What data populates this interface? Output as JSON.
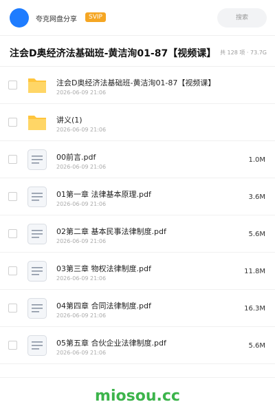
{
  "header": {
    "share_name": "夸克网盘分享",
    "badge": "SVIP",
    "search_label": "搜索"
  },
  "titlebar": {
    "title": "注会D奥经济法基础班-黄洁洵01-87【视频课】",
    "meta": "共 128 项 · 73.7G"
  },
  "files": [
    {
      "type": "folder",
      "name": "注会D奥经济法基础班-黄洁洵01-87【视频课】",
      "date": "2026-06-09 21:06",
      "size": ""
    },
    {
      "type": "folder",
      "name": "讲义(1)",
      "date": "2026-06-09 21:06",
      "size": ""
    },
    {
      "type": "pdf",
      "name": "00前言.pdf",
      "date": "2026-06-09 21:06",
      "size": "1.0M"
    },
    {
      "type": "pdf",
      "name": "01第一章 法律基本原理.pdf",
      "date": "2026-06-09 21:06",
      "size": "3.6M"
    },
    {
      "type": "pdf",
      "name": "02第二章  基本民事法律制度.pdf",
      "date": "2026-06-09 21:06",
      "size": "5.6M"
    },
    {
      "type": "pdf",
      "name": "03第三章 物权法律制度.pdf",
      "date": "2026-06-09 21:06",
      "size": "11.8M"
    },
    {
      "type": "pdf",
      "name": "04第四章 合同法律制度.pdf",
      "date": "2026-06-09 21:06",
      "size": "16.3M"
    },
    {
      "type": "pdf",
      "name": "05第五章 合伙企业法律制度.pdf",
      "date": "2026-06-09 21:06",
      "size": "5.6M"
    }
  ],
  "footer": {
    "brand": "miosou.cc"
  },
  "colors": {
    "accent": "#1e7cff",
    "svip": "#f5a623",
    "folder": "#ffc53d",
    "brand": "#3cb44b"
  },
  "icons": {
    "folder": "folder-icon",
    "pdf": "document-icon"
  }
}
